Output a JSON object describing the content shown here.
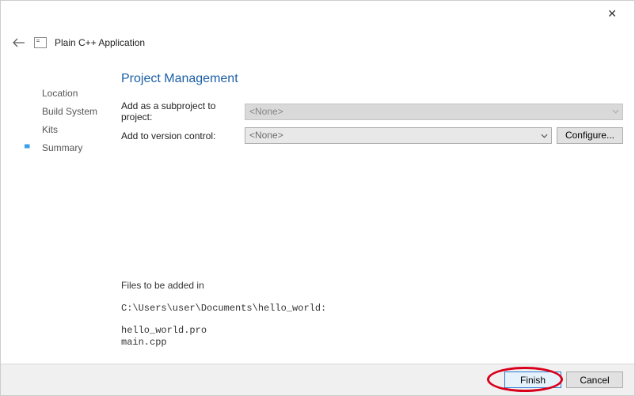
{
  "window": {
    "wizard_title": "Plain C++ Application"
  },
  "sidebar": {
    "steps": [
      "Location",
      "Build System",
      "Kits",
      "Summary"
    ],
    "current_index": 3
  },
  "page": {
    "title": "Project Management",
    "subproject_label": "Add as a subproject to project:",
    "subproject_value": "<None>",
    "vcs_label": "Add to version control:",
    "vcs_value": "<None>",
    "configure_label": "Configure...",
    "files_heading": "Files to be added in",
    "files_path": "C:\\Users\\user\\Documents\\hello_world:",
    "files_list": "hello_world.pro\nmain.cpp"
  },
  "footer": {
    "finish_label": "Finish",
    "cancel_label": "Cancel"
  }
}
